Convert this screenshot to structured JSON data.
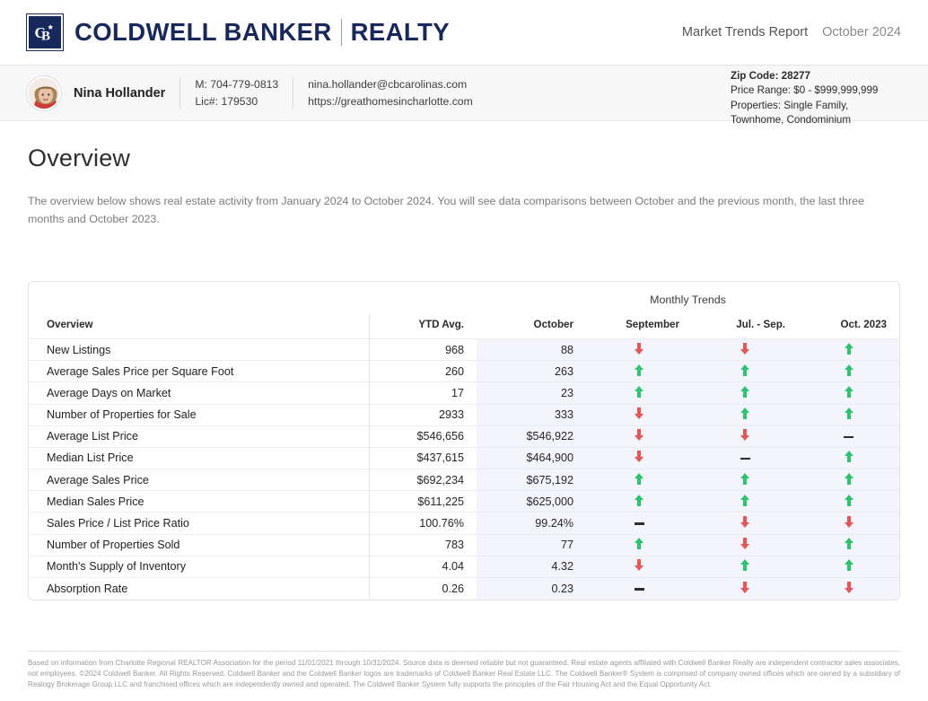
{
  "header": {
    "brand_primary": "COLDWELL BANKER",
    "brand_secondary": "REALTY",
    "logo_icon": "cb-monogram-logo",
    "report_title": "Market Trends Report",
    "report_date": "October 2024"
  },
  "agent": {
    "avatar_icon": "agent-headshot-avatar",
    "name": "Nina Hollander",
    "mobile": "M: 704-779-0813",
    "license": "Lic#: 179530",
    "email": "nina.hollander@cbcarolinas.com",
    "website": "https://greathomesincharlotte.com"
  },
  "criteria": {
    "zip_label": "Zip Code: 28277",
    "price_range": "Price Range: $0 - $999,999,999",
    "properties": "Properties: Single Family, Townhome, Condominium"
  },
  "overview": {
    "title": "Overview",
    "description": "The overview below shows real estate activity from January 2024 to October 2024. You will see data comparisons between October and the previous month, the last three months and October 2023."
  },
  "table": {
    "group_header": "Monthly Trends",
    "columns": [
      "Overview",
      "YTD Avg.",
      "October",
      "September",
      "Jul. - Sep.",
      "Oct. 2023"
    ],
    "rows": [
      {
        "label": "New Listings",
        "ytd": "968",
        "october": "88",
        "september": "down",
        "jul_sep": "down",
        "oct_2023": "up"
      },
      {
        "label": "Average Sales Price per Square Foot",
        "ytd": "260",
        "october": "263",
        "september": "up",
        "jul_sep": "up",
        "oct_2023": "up"
      },
      {
        "label": "Average Days on Market",
        "ytd": "17",
        "october": "23",
        "september": "up",
        "jul_sep": "up",
        "oct_2023": "up"
      },
      {
        "label": "Number of Properties for Sale",
        "ytd": "2933",
        "october": "333",
        "september": "down",
        "jul_sep": "up",
        "oct_2023": "up"
      },
      {
        "label": "Average List Price",
        "ytd": "$546,656",
        "october": "$546,922",
        "september": "down",
        "jul_sep": "down",
        "oct_2023": "flat"
      },
      {
        "label": "Median List Price",
        "ytd": "$437,615",
        "october": "$464,900",
        "september": "down",
        "jul_sep": "flat",
        "oct_2023": "up"
      },
      {
        "label": "Average Sales Price",
        "ytd": "$692,234",
        "october": "$675,192",
        "september": "up",
        "jul_sep": "up",
        "oct_2023": "up"
      },
      {
        "label": "Median Sales Price",
        "ytd": "$611,225",
        "october": "$625,000",
        "september": "up",
        "jul_sep": "up",
        "oct_2023": "up"
      },
      {
        "label": "Sales Price / List Price Ratio",
        "ytd": "100.76%",
        "october": "99.24%",
        "september": "flat",
        "jul_sep": "down",
        "oct_2023": "down"
      },
      {
        "label": "Number of Properties Sold",
        "ytd": "783",
        "october": "77",
        "september": "up",
        "jul_sep": "down",
        "oct_2023": "up"
      },
      {
        "label": "Month's Supply of Inventory",
        "ytd": "4.04",
        "october": "4.32",
        "september": "down",
        "jul_sep": "up",
        "oct_2023": "up"
      },
      {
        "label": "Absorption Rate",
        "ytd": "0.26",
        "october": "0.23",
        "september": "flat",
        "jul_sep": "down",
        "oct_2023": "down"
      }
    ]
  },
  "footer": {
    "disclaimer": "Based on information from Charlotte Regional REALTOR Association for the period 11/01/2021 through 10/31/2024. Source data is deemed reliable but not guaranteed. Real estate agents affiliated with Coldwell Banker Realty are independent contractor sales associates, not employees. ©2024 Coldwell Banker. All Rights Reserved. Coldwell Banker and the Coldwell Banker logos are trademarks of Coldwell Banker Real Estate LLC. The Coldwell Banker® System is comprised of company owned offices which are owned by a subsidiary of Realogy Brokerage Group LLC and franchised offices which are independently owned and operated. The Coldwell Banker System fully supports the principles of the Fair Housing Act and the Equal Opportunity Act."
  },
  "colors": {
    "brand_navy": "#16285c",
    "up_green": "#28c76f",
    "down_red": "#ea5455",
    "flat_dark": "#2e2e2e",
    "tint": "#f4f5fc"
  }
}
